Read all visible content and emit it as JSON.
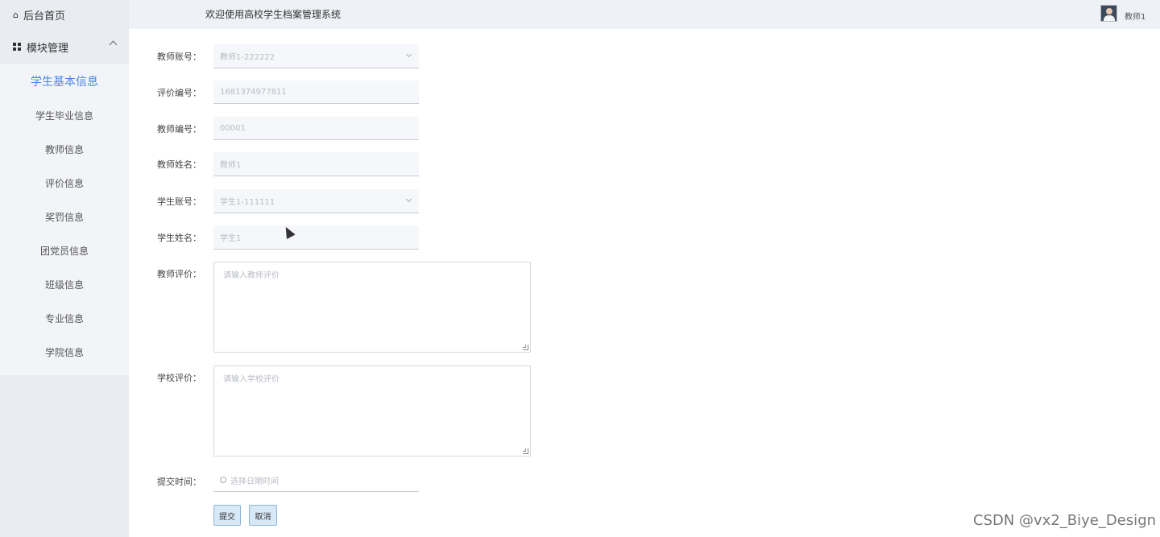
{
  "sidebar": {
    "home_label": "后台首页",
    "module_label": "模块管理",
    "items": [
      {
        "label": "学生基本信息",
        "active": true
      },
      {
        "label": "学生毕业信息"
      },
      {
        "label": "教师信息"
      },
      {
        "label": "评价信息"
      },
      {
        "label": "奖罚信息"
      },
      {
        "label": "团党员信息"
      },
      {
        "label": "班级信息"
      },
      {
        "label": "专业信息"
      },
      {
        "label": "学院信息"
      }
    ]
  },
  "header": {
    "title": "欢迎使用高校学生档案管理系统",
    "user": "教师1"
  },
  "form": {
    "teacher_account": {
      "label": "教师账号：",
      "value": "教师1-222222"
    },
    "eval_no": {
      "label": "评价编号：",
      "value": "1681374977811"
    },
    "teacher_no": {
      "label": "教师编号：",
      "value": "00001"
    },
    "teacher_name": {
      "label": "教师姓名：",
      "value": "教师1"
    },
    "student_account": {
      "label": "学生账号：",
      "value": "学生1-111111"
    },
    "student_name": {
      "label": "学生姓名：",
      "value": "学生1"
    },
    "teacher_eval": {
      "label": "教师评价：",
      "placeholder": "请输入教师评价"
    },
    "school_eval": {
      "label": "学校评价：",
      "placeholder": "请输入学校评价"
    },
    "submit_time": {
      "label": "提交时间：",
      "placeholder": "选择日期时间"
    },
    "submit_button": "提交",
    "cancel_button": "取消"
  },
  "watermark": "CSDN @vx2_Biye_Design",
  "colors": {
    "accent": "#4a86e8",
    "sidebar_bg": "#e9ecf1",
    "button_bg": "#d7e8f7"
  }
}
